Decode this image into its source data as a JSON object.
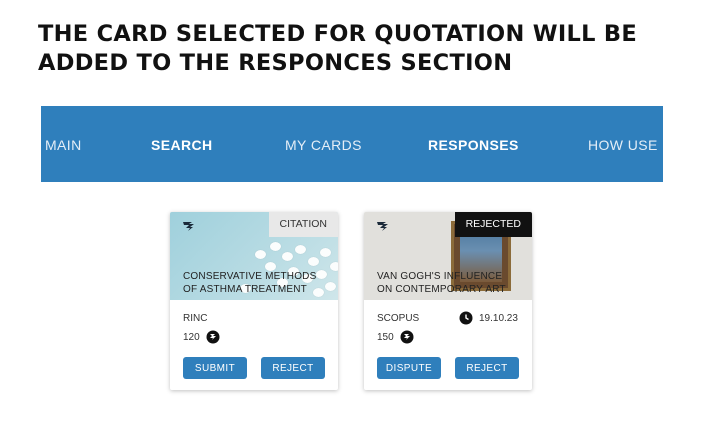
{
  "heading": {
    "line1": "THE CARD SELECTED FOR QUOTATION WILL BE",
    "line2": "ADDED TO THE RESPONCES SECTION"
  },
  "nav": {
    "items": [
      {
        "label": "MAIN",
        "active": false
      },
      {
        "label": "SEARCH",
        "active": false
      },
      {
        "label": "MY CARDS",
        "active": false
      },
      {
        "label": "RESPONSES",
        "active": true
      },
      {
        "label": "HOW USE",
        "active": false
      }
    ]
  },
  "cards": [
    {
      "tag": "CITATION",
      "title_line1": "CONSERVATIVE METHODS",
      "title_line2": "OF ASTHMA TREATMENT",
      "source": "RINC",
      "price": "120",
      "primary_button": "SUBMIT",
      "secondary_button": "REJECT",
      "icons": [
        "logo-icon",
        "coin-icon"
      ]
    },
    {
      "tag": "REJECTED",
      "title_line1": "VAN GOGH'S INFLUENCE",
      "title_line2": "ON CONTEMPORARY ART",
      "source": "SCOPUS",
      "price": "150",
      "date": "19.10.23",
      "primary_button": "DISPUTE",
      "secondary_button": "REJECT",
      "icons": [
        "logo-icon",
        "coin-icon",
        "clock-icon"
      ]
    }
  ],
  "colors": {
    "nav_bg": "#2f7fbc",
    "button_bg": "#2f7fbc",
    "rejected_tag": "#111111"
  }
}
